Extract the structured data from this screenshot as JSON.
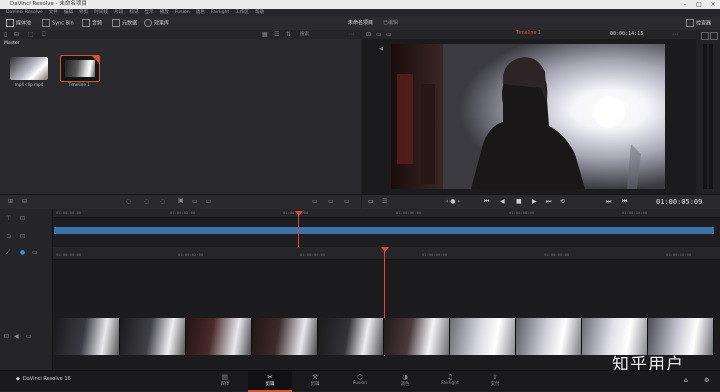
{
  "window": {
    "title": "DaVinci Resolve - 未命名项目"
  },
  "menu": [
    "DaVinci Resolve",
    "文件",
    "编辑",
    "修剪",
    "时间线",
    "片段",
    "标记",
    "显示",
    "播放",
    "Fusion",
    "调色",
    "Fairlight",
    "工作区",
    "帮助"
  ],
  "toolbar": {
    "media_storage": "媒体池",
    "sync_bin": "Sync Bin",
    "audio": "音频",
    "metadata": "元数据",
    "project_name": "未命名项目",
    "edited": "已编辑",
    "effects": "效果库",
    "inspector": "检查器",
    "search": "搜索"
  },
  "media_pool": {
    "bin_name": "Master",
    "clips": [
      {
        "label": "mp4 clip.mp4"
      },
      {
        "label": "Timeline 1"
      }
    ]
  },
  "viewer": {
    "timeline_name": "Timeline 1",
    "duration_tc": "00:00:14:13",
    "current_tc": "01:00:05:09"
  },
  "upper_ruler": [
    "01:00:00:00",
    "01:00:02:00",
    "01:00:04:00",
    "01:00:06:00",
    "01:00:08:00",
    "01:00:10:00"
  ],
  "lower_ruler": [
    "01:00:00:00",
    "01:00:02:00",
    "01:00:04:00",
    "01:00:06:00",
    "01:00:08:00",
    "01:00:10:00",
    "01:00:12:00"
  ],
  "pages": [
    {
      "label": "媒体",
      "glyph": "▤"
    },
    {
      "label": "剪辑",
      "glyph": "✂"
    },
    {
      "label": "剪辑",
      "glyph": "⚒"
    },
    {
      "label": "Fusion",
      "glyph": "⬡"
    },
    {
      "label": "调色",
      "glyph": "◑"
    },
    {
      "label": "Fairlight",
      "glyph": "♫"
    },
    {
      "label": "交付",
      "glyph": "⇪"
    }
  ],
  "app_version": "DaVinci Resolve 16",
  "watermark": "知乎用户",
  "colors": {
    "accent": "#d8532b",
    "playhead": "#e0443b",
    "timeline_bar": "#3b73a8"
  }
}
